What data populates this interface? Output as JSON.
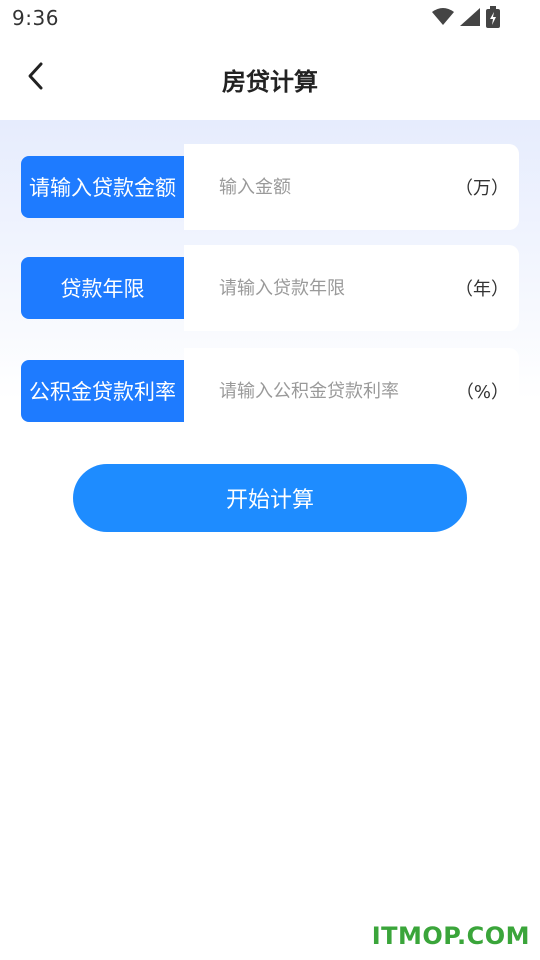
{
  "status_bar": {
    "time": "9:36",
    "icons": [
      "wifi-icon",
      "signal-icon",
      "battery-charging-icon"
    ]
  },
  "header": {
    "title": "房贷计算",
    "back_icon": "chevron-left-icon"
  },
  "form": {
    "rows": [
      {
        "label": "请输入贷款金额",
        "value": "",
        "placeholder": "输入金额",
        "unit": "（万）"
      },
      {
        "label": "贷款年限",
        "value": "",
        "placeholder": "请输入贷款年限",
        "unit": "（年）"
      },
      {
        "label": "公积金贷款利率",
        "value": "",
        "placeholder": "请输入公积金贷款利率",
        "unit": "（%）"
      }
    ]
  },
  "actions": {
    "start_label": "开始计算"
  },
  "watermark": "ITMOP.COM",
  "colors": {
    "label_bg": "#1e7bff",
    "button_bg": "#1e8cff",
    "header_gradient_top": "#e6ecfd",
    "watermark": "#3aa53a"
  }
}
